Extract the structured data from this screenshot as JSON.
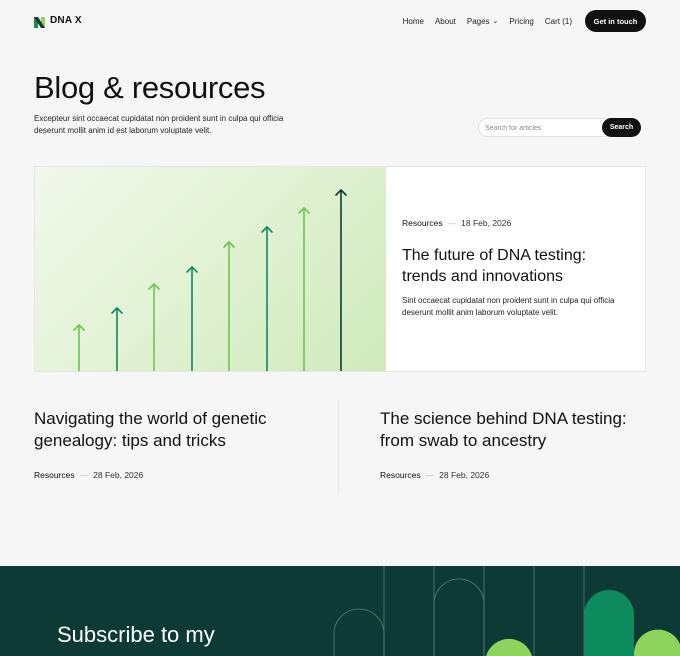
{
  "brand": {
    "name": "DNA X",
    "logo_icon": "dna-x-logo-icon"
  },
  "nav": {
    "items": [
      {
        "label": "Home"
      },
      {
        "label": "About"
      },
      {
        "label": "Pages"
      },
      {
        "label": "Pricing"
      },
      {
        "label": "Cart (1)"
      }
    ],
    "cta": "Get in touch"
  },
  "hero": {
    "title": "Blog & resources",
    "description": "Excepteur sint occaecat cupidatat non proident sunt in culpa qui officia deserunt mollit anim id est laborum voluptate velit."
  },
  "search": {
    "placeholder": "Search for articles",
    "button": "Search"
  },
  "featured": {
    "category": "Resources",
    "separator": "—",
    "date": "18 Feb, 2026",
    "title": "The future of DNA testing: trends and innovations",
    "description": "Sint occaecat cupidatat non proident sunt in culpa qui officia deserunt mollit anim laborum voluptate velit."
  },
  "posts": [
    {
      "title": "Navigating the world of genetic genealogy: tips and tricks",
      "category": "Resources",
      "separator": "—",
      "date": "28 Feb, 2026"
    },
    {
      "title": "The science behind DNA testing: from swab to ancestry",
      "category": "Resources",
      "separator": "—",
      "date": "28 Feb, 2026"
    }
  ],
  "newsletter": {
    "title": "Subscribe to my newsletter today!"
  },
  "colors": {
    "accent_dark": "#0d3a34",
    "accent_green": "#8ed35c",
    "accent_teal": "#0e8a5f",
    "button": "#111111"
  }
}
